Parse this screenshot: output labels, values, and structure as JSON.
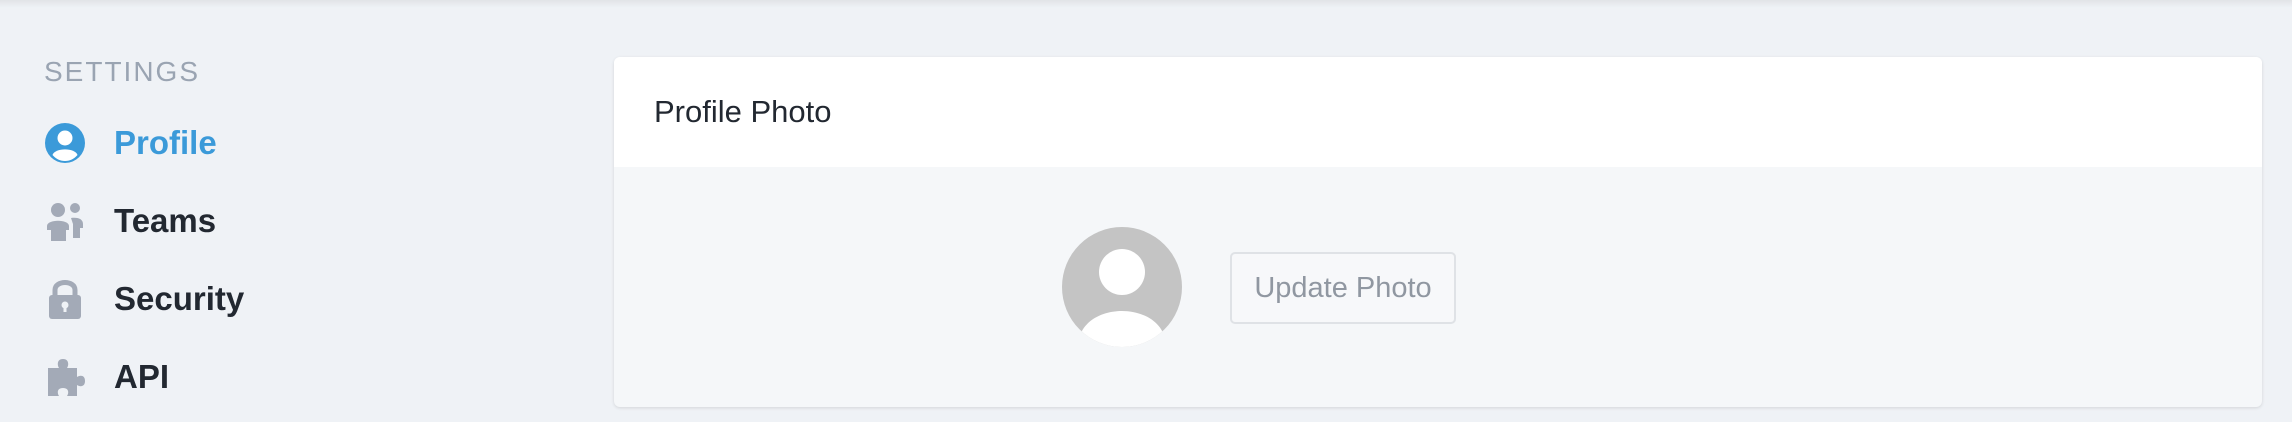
{
  "sidebar": {
    "heading": "SETTINGS",
    "items": [
      {
        "label": "Profile",
        "icon": "user-circle-icon",
        "active": true
      },
      {
        "label": "Teams",
        "icon": "team-icon",
        "active": false
      },
      {
        "label": "Security",
        "icon": "lock-icon",
        "active": false
      },
      {
        "label": "API",
        "icon": "puzzle-icon",
        "active": false
      }
    ]
  },
  "card": {
    "title": "Profile Photo",
    "update_button_label": "Update Photo",
    "avatar_icon": "default-avatar-icon"
  },
  "colors": {
    "accent": "#3b9ad9",
    "background": "#eff2f6",
    "icon_gray": "#a3aab7",
    "text_dark": "#222831"
  }
}
